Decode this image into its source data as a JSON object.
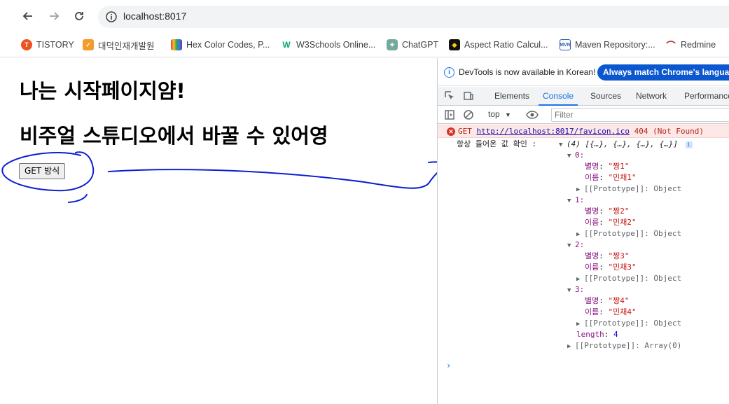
{
  "browser": {
    "url": "localhost:8017",
    "bookmarks": [
      {
        "label": "TISTORY",
        "icon": "tistory-icon",
        "color": "#eb531f"
      },
      {
        "label": "대덕인재개발원",
        "icon": "ddit-icon",
        "color": "#f59b2b"
      },
      {
        "label": "Hex Color Codes, P...",
        "icon": "hex-color-icon",
        "color": "#7b3fe4"
      },
      {
        "label": "W3Schools Online...",
        "icon": "w3schools-icon",
        "color": "#04aa6d"
      },
      {
        "label": "ChatGPT",
        "icon": "chatgpt-icon",
        "color": "#74aa9c"
      },
      {
        "label": "Aspect Ratio Calcul...",
        "icon": "aspect-ratio-icon",
        "color": "#111111"
      },
      {
        "label": "Maven Repository:...",
        "icon": "maven-icon",
        "color": "#2c5fa8"
      },
      {
        "label": "Redmine",
        "icon": "redmine-icon",
        "color": "#b32024"
      }
    ]
  },
  "page": {
    "heading1": "나는 시작페이지얌!",
    "heading2": "비주얼 스튜디오에서 바꿀 수 있어영",
    "get_button": "GET 방식"
  },
  "devtools": {
    "infobar_msg": "DevTools is now available in Korean!",
    "infobar_button": "Always match Chrome's language",
    "tabs": [
      "Elements",
      "Console",
      "Sources",
      "Network",
      "Performance"
    ],
    "active_tab": "Console",
    "context": "top",
    "filter_placeholder": "Filter",
    "error": {
      "method": "GET",
      "url": "http://localhost:8017/favicon.ico",
      "status": "404 (Not Found)"
    },
    "log_label": "항상 들어온 값 확인 :",
    "array_summary": "(4) [{…}, {…}, {…}, {…}]",
    "items": [
      {
        "index": "0:",
        "nick_key": "별명",
        "nick": "\"짱1\"",
        "name_key": "이름",
        "name": "\"민채1\""
      },
      {
        "index": "1:",
        "nick_key": "별명",
        "nick": "\"짱2\"",
        "name_key": "이름",
        "name": "\"민채2\""
      },
      {
        "index": "2:",
        "nick_key": "별명",
        "nick": "\"짱3\"",
        "name_key": "이름",
        "name": "\"민채3\""
      },
      {
        "index": "3:",
        "nick_key": "별명",
        "nick": "\"짱4\"",
        "name_key": "이름",
        "name": "\"민채4\""
      }
    ],
    "proto_object": "[[Prototype]]: Object",
    "length_key": "length",
    "length_value": "4",
    "proto_array": "[[Prototype]]: Array(0)"
  }
}
